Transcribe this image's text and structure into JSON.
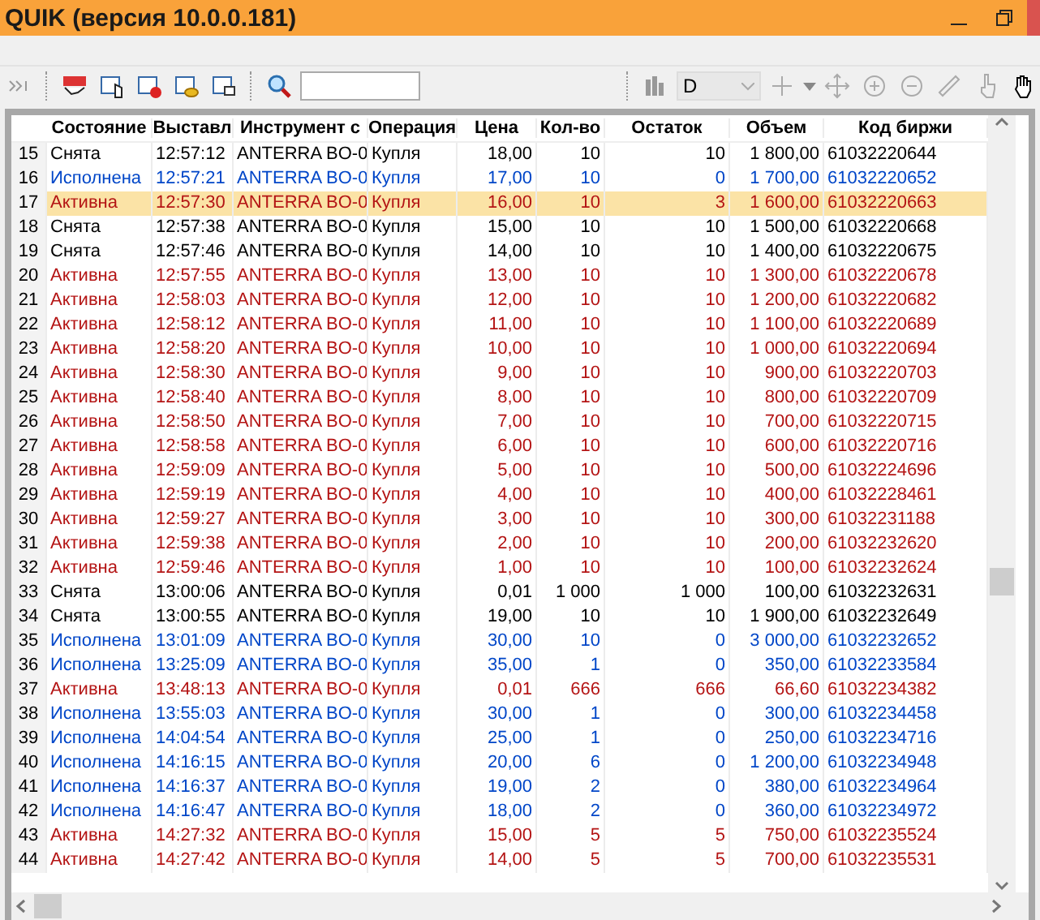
{
  "window": {
    "title": "QUIK (версия 10.0.0.181)"
  },
  "toolbar": {
    "interval": "D"
  },
  "table": {
    "columns": [
      "",
      "Состояние",
      "Выставл",
      "Инструмент с",
      "Операция",
      "Цена",
      "Кол-во",
      "Остаток",
      "Объем",
      "Код биржи"
    ],
    "rows": [
      {
        "cells": [
          "15",
          "Снята",
          "12:57:12",
          "ANTERRA BO-0",
          "Купля",
          "18,00",
          "10",
          "10",
          "1 800,00",
          "61032220644"
        ],
        "kind": "cancelled",
        "selected": false
      },
      {
        "cells": [
          "16",
          "Исполнена",
          "12:57:21",
          "ANTERRA BO-0",
          "Купля",
          "17,00",
          "10",
          "0",
          "1 700,00",
          "61032220652"
        ],
        "kind": "filled",
        "selected": false
      },
      {
        "cells": [
          "17",
          "Активна",
          "12:57:30",
          "ANTERRA BO-0",
          "Купля",
          "16,00",
          "10",
          "3",
          "1 600,00",
          "61032220663"
        ],
        "kind": "active",
        "selected": true
      },
      {
        "cells": [
          "18",
          "Снята",
          "12:57:38",
          "ANTERRA BO-0",
          "Купля",
          "15,00",
          "10",
          "10",
          "1 500,00",
          "61032220668"
        ],
        "kind": "cancelled",
        "selected": false
      },
      {
        "cells": [
          "19",
          "Снята",
          "12:57:46",
          "ANTERRA BO-0",
          "Купля",
          "14,00",
          "10",
          "10",
          "1 400,00",
          "61032220675"
        ],
        "kind": "cancelled",
        "selected": false
      },
      {
        "cells": [
          "20",
          "Активна",
          "12:57:55",
          "ANTERRA BO-0",
          "Купля",
          "13,00",
          "10",
          "10",
          "1 300,00",
          "61032220678"
        ],
        "kind": "active",
        "selected": false
      },
      {
        "cells": [
          "21",
          "Активна",
          "12:58:03",
          "ANTERRA BO-0",
          "Купля",
          "12,00",
          "10",
          "10",
          "1 200,00",
          "61032220682"
        ],
        "kind": "active",
        "selected": false
      },
      {
        "cells": [
          "22",
          "Активна",
          "12:58:12",
          "ANTERRA BO-0",
          "Купля",
          "11,00",
          "10",
          "10",
          "1 100,00",
          "61032220689"
        ],
        "kind": "active",
        "selected": false
      },
      {
        "cells": [
          "23",
          "Активна",
          "12:58:20",
          "ANTERRA BO-0",
          "Купля",
          "10,00",
          "10",
          "10",
          "1 000,00",
          "61032220694"
        ],
        "kind": "active",
        "selected": false
      },
      {
        "cells": [
          "24",
          "Активна",
          "12:58:30",
          "ANTERRA BO-0",
          "Купля",
          "9,00",
          "10",
          "10",
          "900,00",
          "61032220703"
        ],
        "kind": "active",
        "selected": false
      },
      {
        "cells": [
          "25",
          "Активна",
          "12:58:40",
          "ANTERRA BO-0",
          "Купля",
          "8,00",
          "10",
          "10",
          "800,00",
          "61032220709"
        ],
        "kind": "active",
        "selected": false
      },
      {
        "cells": [
          "26",
          "Активна",
          "12:58:50",
          "ANTERRA BO-0",
          "Купля",
          "7,00",
          "10",
          "10",
          "700,00",
          "61032220715"
        ],
        "kind": "active",
        "selected": false
      },
      {
        "cells": [
          "27",
          "Активна",
          "12:58:58",
          "ANTERRA BO-0",
          "Купля",
          "6,00",
          "10",
          "10",
          "600,00",
          "61032220716"
        ],
        "kind": "active",
        "selected": false
      },
      {
        "cells": [
          "28",
          "Активна",
          "12:59:09",
          "ANTERRA BO-0",
          "Купля",
          "5,00",
          "10",
          "10",
          "500,00",
          "61032224696"
        ],
        "kind": "active",
        "selected": false
      },
      {
        "cells": [
          "29",
          "Активна",
          "12:59:19",
          "ANTERRA BO-0",
          "Купля",
          "4,00",
          "10",
          "10",
          "400,00",
          "61032228461"
        ],
        "kind": "active",
        "selected": false
      },
      {
        "cells": [
          "30",
          "Активна",
          "12:59:27",
          "ANTERRA BO-0",
          "Купля",
          "3,00",
          "10",
          "10",
          "300,00",
          "61032231188"
        ],
        "kind": "active",
        "selected": false
      },
      {
        "cells": [
          "31",
          "Активна",
          "12:59:38",
          "ANTERRA BO-0",
          "Купля",
          "2,00",
          "10",
          "10",
          "200,00",
          "61032232620"
        ],
        "kind": "active",
        "selected": false
      },
      {
        "cells": [
          "32",
          "Активна",
          "12:59:46",
          "ANTERRA BO-0",
          "Купля",
          "1,00",
          "10",
          "10",
          "100,00",
          "61032232624"
        ],
        "kind": "active",
        "selected": false
      },
      {
        "cells": [
          "33",
          "Снята",
          "13:00:06",
          "ANTERRA BO-0",
          "Купля",
          "0,01",
          "1 000",
          "1 000",
          "100,00",
          "61032232631"
        ],
        "kind": "cancelled",
        "selected": false
      },
      {
        "cells": [
          "34",
          "Снята",
          "13:00:55",
          "ANTERRA BO-0",
          "Купля",
          "19,00",
          "10",
          "10",
          "1 900,00",
          "61032232649"
        ],
        "kind": "cancelled",
        "selected": false
      },
      {
        "cells": [
          "35",
          "Исполнена",
          "13:01:09",
          "ANTERRA BO-0",
          "Купля",
          "30,00",
          "10",
          "0",
          "3 000,00",
          "61032232652"
        ],
        "kind": "filled",
        "selected": false
      },
      {
        "cells": [
          "36",
          "Исполнена",
          "13:25:09",
          "ANTERRA BO-0",
          "Купля",
          "35,00",
          "1",
          "0",
          "350,00",
          "61032233584"
        ],
        "kind": "filled",
        "selected": false
      },
      {
        "cells": [
          "37",
          "Активна",
          "13:48:13",
          "ANTERRA BO-0",
          "Купля",
          "0,01",
          "666",
          "666",
          "66,60",
          "61032234382"
        ],
        "kind": "active",
        "selected": false
      },
      {
        "cells": [
          "38",
          "Исполнена",
          "13:55:03",
          "ANTERRA BO-0",
          "Купля",
          "30,00",
          "1",
          "0",
          "300,00",
          "61032234458"
        ],
        "kind": "filled",
        "selected": false
      },
      {
        "cells": [
          "39",
          "Исполнена",
          "14:04:54",
          "ANTERRA BO-0",
          "Купля",
          "25,00",
          "1",
          "0",
          "250,00",
          "61032234716"
        ],
        "kind": "filled",
        "selected": false
      },
      {
        "cells": [
          "40",
          "Исполнена",
          "14:16:15",
          "ANTERRA BO-0",
          "Купля",
          "20,00",
          "6",
          "0",
          "1 200,00",
          "61032234948"
        ],
        "kind": "filled",
        "selected": false
      },
      {
        "cells": [
          "41",
          "Исполнена",
          "14:16:37",
          "ANTERRA BO-0",
          "Купля",
          "19,00",
          "2",
          "0",
          "380,00",
          "61032234964"
        ],
        "kind": "filled",
        "selected": false
      },
      {
        "cells": [
          "42",
          "Исполнена",
          "14:16:47",
          "ANTERRA BO-0",
          "Купля",
          "18,00",
          "2",
          "0",
          "360,00",
          "61032234972"
        ],
        "kind": "filled",
        "selected": false
      },
      {
        "cells": [
          "43",
          "Активна",
          "14:27:32",
          "ANTERRA BO-0",
          "Купля",
          "15,00",
          "5",
          "5",
          "750,00",
          "61032235524"
        ],
        "kind": "active",
        "selected": false
      },
      {
        "cells": [
          "44",
          "Активна",
          "14:27:42",
          "ANTERRA BO-0",
          "Купля",
          "14,00",
          "5",
          "5",
          "700,00",
          "61032235531"
        ],
        "kind": "active",
        "selected": false
      }
    ]
  }
}
